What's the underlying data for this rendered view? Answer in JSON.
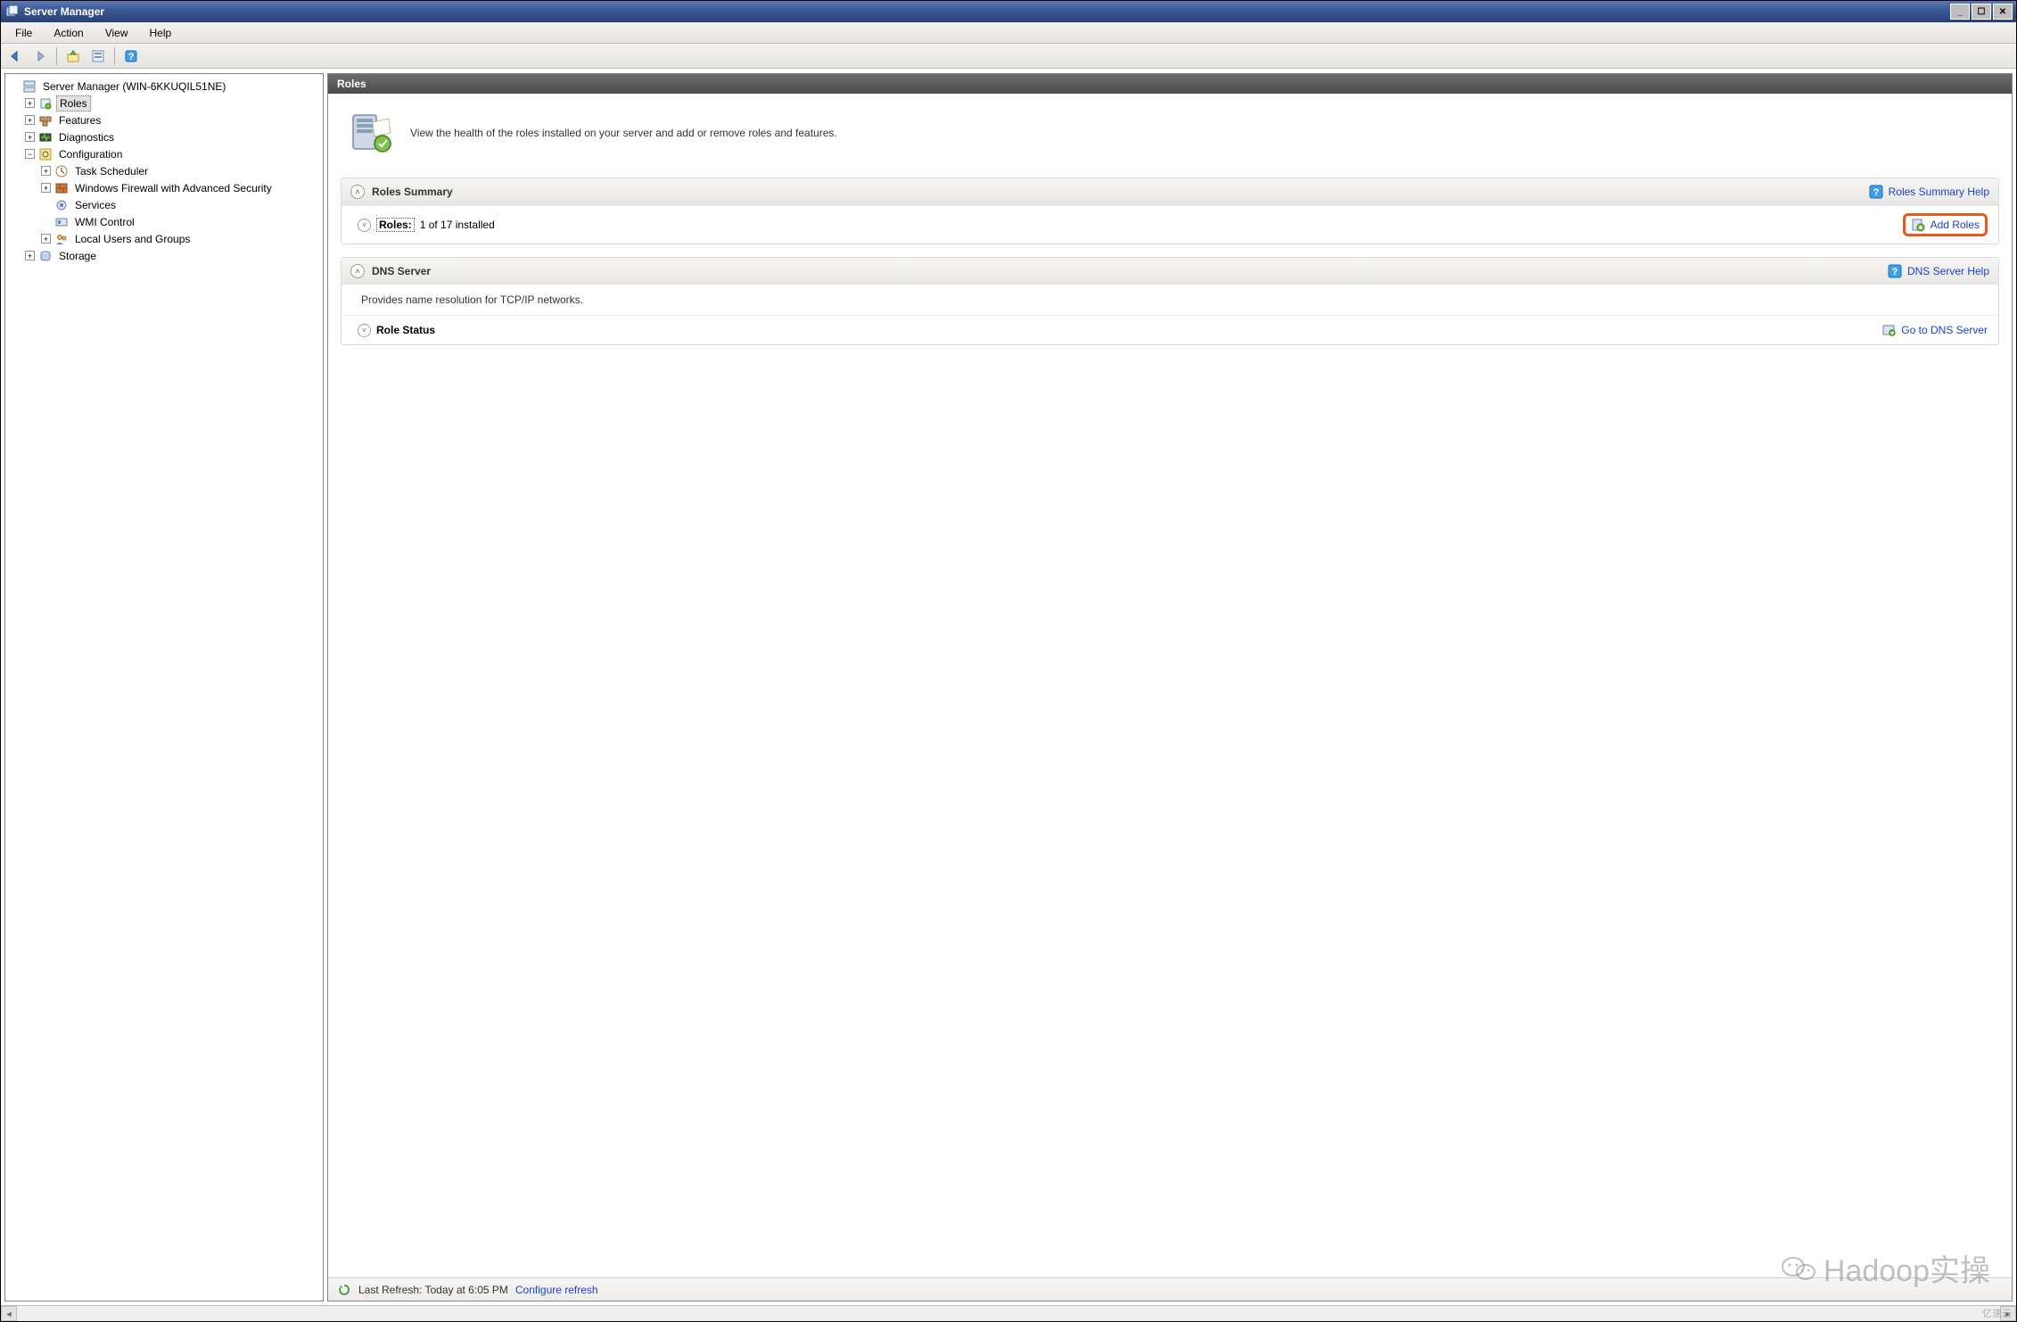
{
  "titlebar": {
    "title": "Server Manager"
  },
  "menubar": {
    "items": [
      "File",
      "Action",
      "View",
      "Help"
    ]
  },
  "tree": {
    "root": "Server Manager (WIN-6KKUQIL51NE)",
    "items": [
      {
        "label": "Roles",
        "expander": "+",
        "selected": true
      },
      {
        "label": "Features",
        "expander": "+"
      },
      {
        "label": "Diagnostics",
        "expander": "+"
      },
      {
        "label": "Configuration",
        "expander": "−",
        "children": [
          {
            "label": "Task Scheduler",
            "expander": "+"
          },
          {
            "label": "Windows Firewall with Advanced Security",
            "expander": "+"
          },
          {
            "label": "Services",
            "expander": ""
          },
          {
            "label": "WMI Control",
            "expander": ""
          },
          {
            "label": "Local Users and Groups",
            "expander": "+"
          }
        ]
      },
      {
        "label": "Storage",
        "expander": "+"
      }
    ]
  },
  "content": {
    "header": "Roles",
    "intro": "View the health of the roles installed on your server and add or remove roles and features.",
    "sections": {
      "summary": {
        "title": "Roles Summary",
        "help": "Roles Summary Help",
        "roles_label": "Roles:",
        "roles_count": "1 of 17 installed",
        "add_roles": "Add Roles"
      },
      "dns": {
        "title": "DNS Server",
        "help": "DNS Server Help",
        "desc": "Provides name resolution for TCP/IP networks.",
        "status_title": "Role Status",
        "goto": "Go to DNS Server"
      }
    }
  },
  "statusbar": {
    "refresh": "Last Refresh: Today at 6:05 PM",
    "configure": "Configure refresh"
  },
  "watermark": "Hadoop实操",
  "corner": "亿速云"
}
